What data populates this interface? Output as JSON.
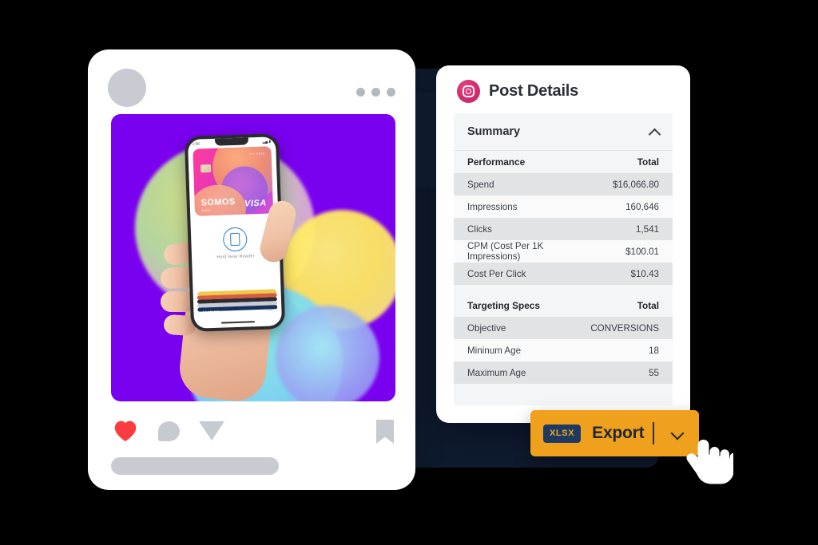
{
  "post_card": {
    "avatar": "avatar-placeholder",
    "more_menu": "more-options-dots",
    "media_alt": "hand-holding-phone-apple-pay",
    "creative": {
      "background_color": "#7a00f0",
      "card_brand": "SOMOS",
      "card_type": "Debit",
      "card_network": "VISA",
      "card_number_hint": "•••• 2420",
      "phone_time": "2:56",
      "wallet_prompt": "Hold Near Reader",
      "wallet_label": "AA MILES",
      "wallet_label_secondary": "Bank"
    },
    "actions": [
      {
        "name": "like",
        "icon": "heart-icon",
        "color": "#fb3b40"
      },
      {
        "name": "comment",
        "icon": "comment-bubble-icon",
        "color": "#c6cad1"
      },
      {
        "name": "share",
        "icon": "send-icon",
        "color": "#c6cad1"
      },
      {
        "name": "save",
        "icon": "bookmark-icon",
        "color": "#c6cad1"
      }
    ],
    "caption_placeholder": "caption-placeholder-bar"
  },
  "details": {
    "icon": "instagram-icon",
    "title": "Post Details",
    "accent_color": "#d22b6e",
    "summary": {
      "label": "Summary",
      "expanded": true,
      "chevron": "chevron-up-icon"
    },
    "tables": [
      {
        "header": {
          "metric": "Performance",
          "total": "Total"
        },
        "rows": [
          {
            "metric": "Spend",
            "total": "$16,066.80"
          },
          {
            "metric": "Impressions",
            "total": "160,646"
          },
          {
            "metric": "Clicks",
            "total": "1,541"
          },
          {
            "metric": "CPM (Cost Per 1K Impressions)",
            "total": "$100.01"
          },
          {
            "metric": "Cost Per Click",
            "total": "$10.43"
          }
        ]
      },
      {
        "header": {
          "metric": "Targeting Specs",
          "total": "Total"
        },
        "rows": [
          {
            "metric": "Objective",
            "total": "CONVERSIONS"
          },
          {
            "metric": "Mininum Age",
            "total": "18"
          },
          {
            "metric": "Maximum Age",
            "total": "55"
          }
        ]
      }
    ]
  },
  "export": {
    "format_badge": "XLSX",
    "label": "Export",
    "dropdown_icon": "chevron-down-icon",
    "button_color": "#efa01d",
    "badge_color": "#1e3a63"
  },
  "cursor": {
    "icon": "pointing-hand-cursor"
  }
}
